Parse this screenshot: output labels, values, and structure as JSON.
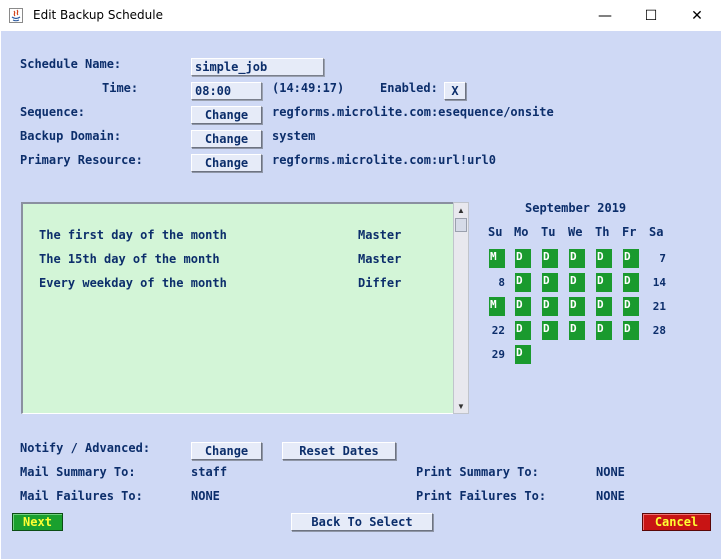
{
  "window": {
    "title": "Edit Backup Schedule",
    "minimize_glyph": "—",
    "maximize_glyph": "☐",
    "close_glyph": "✕"
  },
  "form": {
    "schedule_name_label": "Schedule Name:",
    "schedule_name_value": "simple_job",
    "time_label": "Time:",
    "time_value": "08:00",
    "time_display": "(14:49:17)",
    "enabled_label": "Enabled:",
    "enabled_value": "X",
    "sequence_label": "Sequence:",
    "sequence_value": "regforms.microlite.com:esequence/onsite",
    "backup_domain_label": "Backup Domain:",
    "backup_domain_value": "system",
    "primary_resource_label": "Primary Resource:",
    "primary_resource_value": "regforms.microlite.com:url!url0",
    "change_label": "Change"
  },
  "schedule_rules": [
    {
      "description": "The first day of the month",
      "type": "Master"
    },
    {
      "description": "The 15th day of the month",
      "type": "Master"
    },
    {
      "description": "Every weekday of the month",
      "type": "Differ"
    }
  ],
  "calendar": {
    "title": "September 2019",
    "weekdays": [
      "Su",
      "Mo",
      "Tu",
      "We",
      "Th",
      "Fr",
      "Sa"
    ],
    "weeks": [
      [
        {
          "mark": "M"
        },
        {
          "mark": "D"
        },
        {
          "mark": "D"
        },
        {
          "mark": "D"
        },
        {
          "mark": "D"
        },
        {
          "mark": "D"
        },
        {
          "day": "7"
        }
      ],
      [
        {
          "day": "8"
        },
        {
          "mark": "D"
        },
        {
          "mark": "D"
        },
        {
          "mark": "D"
        },
        {
          "mark": "D"
        },
        {
          "mark": "D"
        },
        {
          "day": "14"
        }
      ],
      [
        {
          "mark": "M"
        },
        {
          "mark": "D"
        },
        {
          "mark": "D"
        },
        {
          "mark": "D"
        },
        {
          "mark": "D"
        },
        {
          "mark": "D"
        },
        {
          "day": "21"
        }
      ],
      [
        {
          "day": "22"
        },
        {
          "mark": "D"
        },
        {
          "mark": "D"
        },
        {
          "mark": "D"
        },
        {
          "mark": "D"
        },
        {
          "mark": "D"
        },
        {
          "day": "28"
        }
      ],
      [
        {
          "day": "29"
        },
        {
          "mark": "D"
        }
      ]
    ],
    "mark_color": "#1a9a2e"
  },
  "notify": {
    "label": "Notify / Advanced:",
    "change_label": "Change",
    "reset_dates_label": "Reset Dates",
    "mail_summary_label": "Mail Summary To:",
    "mail_summary_value": "staff",
    "mail_failures_label": "Mail Failures To:",
    "mail_failures_value": "NONE",
    "print_summary_label": "Print Summary To:",
    "print_summary_value": "NONE",
    "print_failures_label": "Print Failures To:",
    "print_failures_value": "NONE"
  },
  "footer": {
    "next_label": "Next",
    "back_label": "Back To Select",
    "cancel_label": "Cancel"
  },
  "colors": {
    "background": "#cfd9f5",
    "text": "#0c2e6b",
    "list_background": "#d3f5d7",
    "next_button": "#1aa02e",
    "cancel_button": "#c81414"
  }
}
